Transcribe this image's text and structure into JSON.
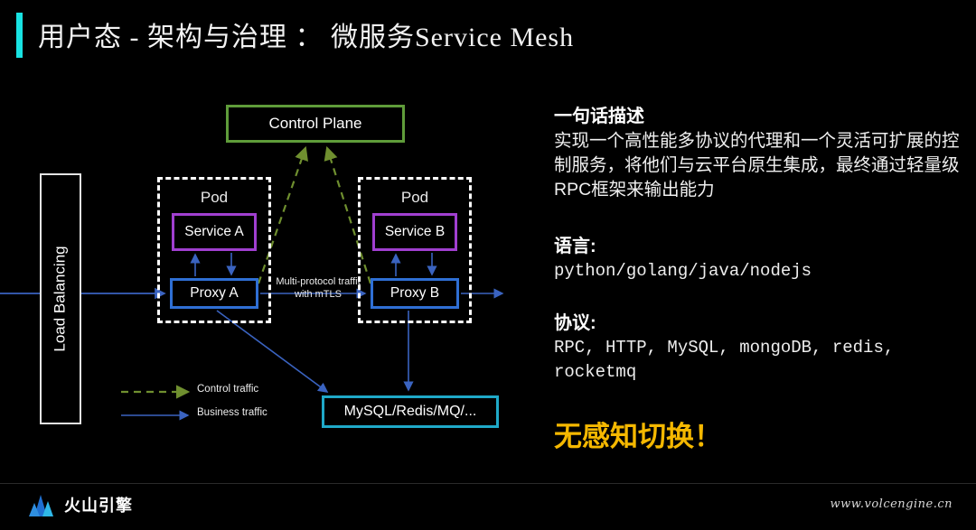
{
  "slide": {
    "title": "用户态 - 架构与治理 ： 微服务Service Mesh",
    "accent_color": "#18e2e2",
    "background": "#000000"
  },
  "diagram": {
    "control_plane": {
      "label": "Control Plane",
      "color": "#5f9c3a"
    },
    "pods": [
      {
        "label": "Pod",
        "service": "Service A",
        "proxy": "Proxy A"
      },
      {
        "label": "Pod",
        "service": "Service B",
        "proxy": "Proxy B"
      }
    ],
    "pod_a_label": "Pod",
    "pod_b_label": "Pod",
    "service_a": "Service A",
    "service_b": "Service B",
    "proxy_a": "Proxy A",
    "proxy_b": "Proxy B",
    "load_balancer": "Load Balancing",
    "datastore": "MySQL/Redis/MQ/...",
    "mid_label_line1": "Multi-protocol traffit",
    "mid_label_line2": "with mTLS",
    "colors": {
      "service_border": "#a03fd0",
      "proxy_border": "#2f6fd4",
      "store_border": "#1fa9c8",
      "control_border": "#5f9c3a",
      "control_traffic": "#6f8f2f",
      "business_traffic": "#3a63c0",
      "pod_border": "#ffffff"
    },
    "legend": [
      {
        "label": "Control traffic",
        "style": "dashed",
        "color": "#6f8f2f"
      },
      {
        "label": "Business traffic",
        "style": "solid",
        "color": "#3a63c0"
      }
    ]
  },
  "panel": {
    "summary_head": "一句话描述",
    "summary_body": "实现一个高性能多协议的代理和一个灵活可扩展的控制服务，将他们与云平台原生集成，最终通过轻量级RPC框架来输出能力",
    "language_head": "语言:",
    "language_value": "python/golang/java/nodejs",
    "protocol_head": "协议:",
    "protocol_value": "RPC, HTTP, MySQL, mongoDB, redis, rocketmq",
    "highlight": "无感知切换！",
    "highlight_color": "#f5b800"
  },
  "footer": {
    "brand": "火山引擎",
    "site": "www.volcengine.cn"
  }
}
